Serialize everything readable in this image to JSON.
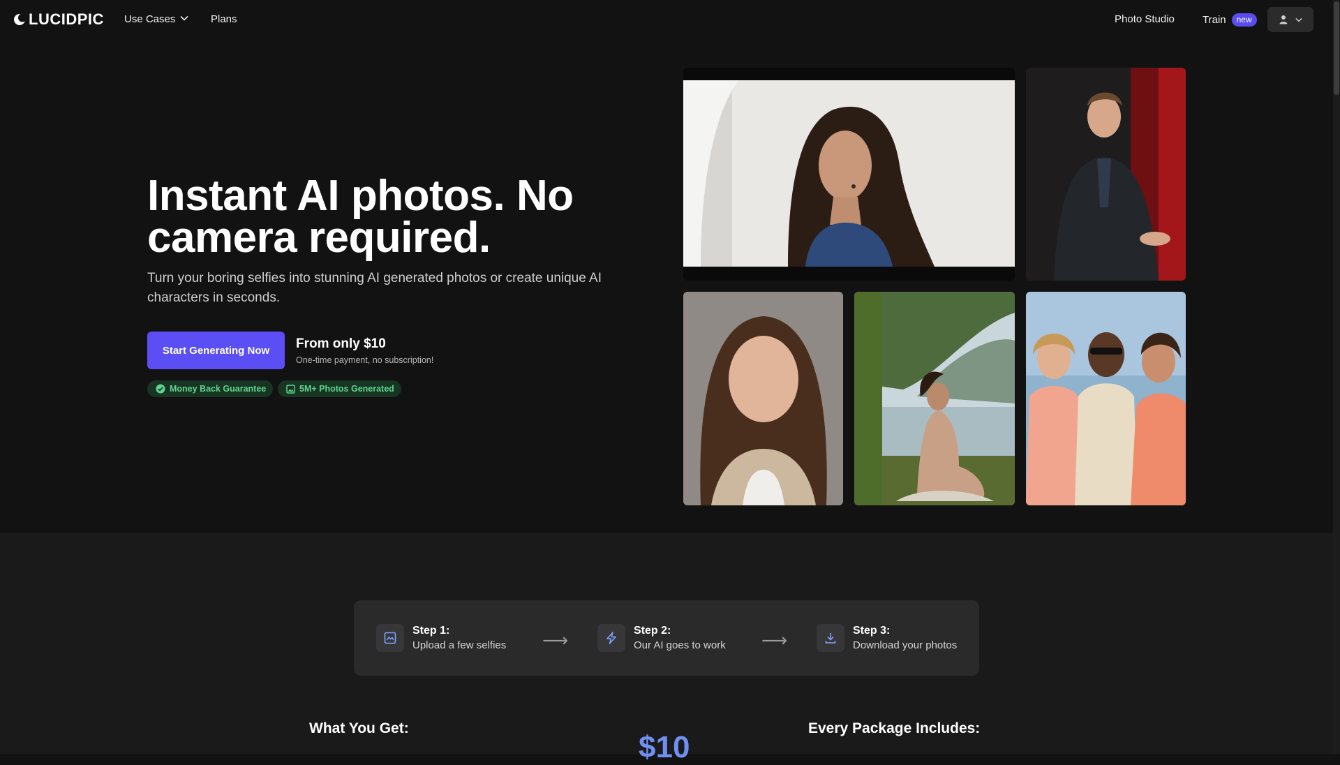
{
  "brand": {
    "name": "LUCIDPIC",
    "logo_icon": "crescent-moon-logo"
  },
  "nav": {
    "use_cases": "Use Cases",
    "plans": "Plans",
    "photo_studio": "Photo Studio",
    "train": "Train",
    "train_badge": "new",
    "user_icon": "user-icon"
  },
  "hero": {
    "headline": "Instant AI photos. No camera required.",
    "subtext": "Turn your boring selfies into stunning AI generated photos or create unique AI characters in seconds.",
    "cta_label": "Start Generating Now",
    "price_lead": "From only $10",
    "price_note": "One-time payment, no subscription!",
    "badges": [
      {
        "label": "Money Back Guarantee",
        "icon": "check-circle-icon"
      },
      {
        "label": "5M+ Photos Generated",
        "icon": "image-icon"
      }
    ]
  },
  "steps": [
    {
      "title": "Step 1:",
      "description": "Upload a few selfies",
      "icon": "upload-image-icon"
    },
    {
      "title": "Step 2:",
      "description": "Our AI goes to work",
      "icon": "lightning-icon"
    },
    {
      "title": "Step 3:",
      "description": "Download your photos",
      "icon": "download-icon"
    }
  ],
  "pricing": {
    "left_heading": "What You Get:",
    "price": "$10",
    "right_heading": "Every Package Includes:"
  },
  "colors": {
    "accent": "#5b4ef4",
    "badge_green": "#5ed58c",
    "price_blue": "#6f8ff2",
    "background": "#131212"
  }
}
